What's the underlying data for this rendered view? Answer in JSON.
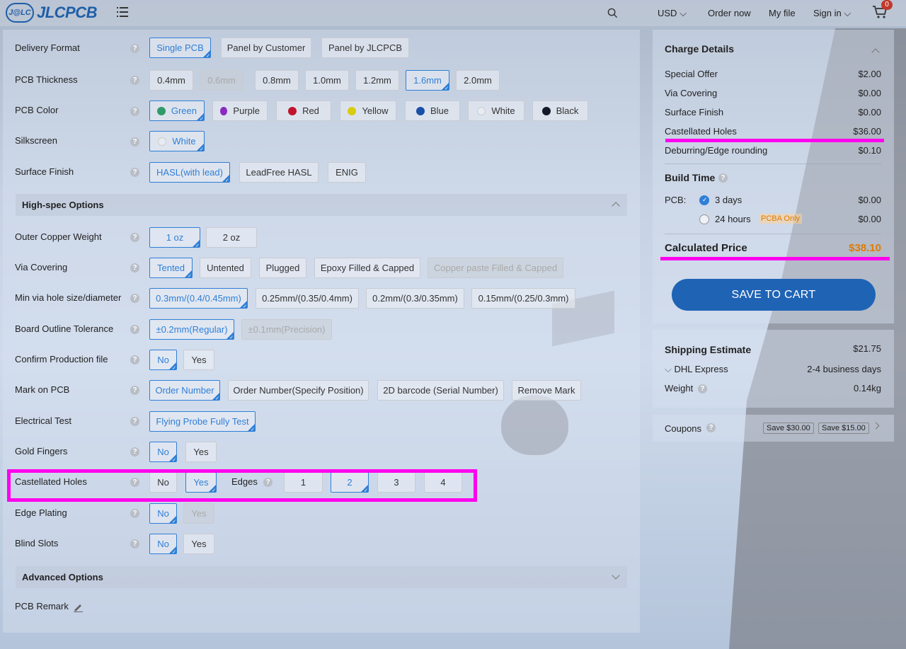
{
  "header": {
    "logo_mark": "J@LC",
    "logo_text": "JLCPCB",
    "currency": "USD",
    "order_now": "Order now",
    "my_file": "My file",
    "sign_in": "Sign in",
    "cart_count": "0"
  },
  "options": {
    "delivery": {
      "label": "Delivery Format",
      "items": [
        "Single PCB",
        "Panel by Customer",
        "Panel by JLCPCB"
      ]
    },
    "thickness": {
      "label": "PCB Thickness",
      "items": [
        "0.4mm",
        "0.6mm",
        "0.8mm",
        "1.0mm",
        "1.2mm",
        "1.6mm",
        "2.0mm"
      ]
    },
    "color": {
      "label": "PCB Color",
      "items": [
        "Green",
        "Purple",
        "Red",
        "Yellow",
        "Blue",
        "White",
        "Black"
      ]
    },
    "silkscreen": {
      "label": "Silkscreen",
      "items": [
        "White"
      ]
    },
    "finish": {
      "label": "Surface Finish",
      "items": [
        "HASL(with lead)",
        "LeadFree HASL",
        "ENIG"
      ]
    },
    "highspec_title": "High-spec Options",
    "copper": {
      "label": "Outer Copper Weight",
      "items": [
        "1 oz",
        "2 oz"
      ]
    },
    "via": {
      "label": "Via Covering",
      "items": [
        "Tented",
        "Untented",
        "Plugged",
        "Epoxy Filled & Capped",
        "Copper paste Filled & Capped"
      ]
    },
    "minvia": {
      "label": "Min via hole size/diameter",
      "items": [
        "0.3mm/(0.4/0.45mm)",
        "0.25mm/(0.35/0.4mm)",
        "0.2mm/(0.3/0.35mm)",
        "0.15mm/(0.25/0.3mm)"
      ]
    },
    "outline": {
      "label": "Board Outline Tolerance",
      "items": [
        "±0.2mm(Regular)",
        "±0.1mm(Precision)"
      ]
    },
    "confirm": {
      "label": "Confirm Production file",
      "items": [
        "No",
        "Yes"
      ]
    },
    "mark": {
      "label": "Mark on PCB",
      "items": [
        "Order Number",
        "Order Number(Specify Position)",
        "2D barcode (Serial Number)",
        "Remove Mark"
      ]
    },
    "etest": {
      "label": "Electrical Test",
      "items": [
        "Flying Probe Fully Test"
      ]
    },
    "gold": {
      "label": "Gold Fingers",
      "items": [
        "No",
        "Yes"
      ]
    },
    "castellated": {
      "label": "Castellated Holes",
      "items": [
        "No",
        "Yes"
      ],
      "edges_label": "Edges",
      "edges": [
        "1",
        "2",
        "3",
        "4"
      ]
    },
    "edgeplating": {
      "label": "Edge Plating",
      "items": [
        "No",
        "Yes"
      ]
    },
    "blindslots": {
      "label": "Blind Slots",
      "items": [
        "No",
        "Yes"
      ]
    },
    "advanced_title": "Advanced Options",
    "remark_label": "PCB Remark"
  },
  "charges": {
    "title": "Charge Details",
    "rows": [
      {
        "label": "Special Offer",
        "value": "$2.00"
      },
      {
        "label": "Via Covering",
        "value": "$0.00"
      },
      {
        "label": "Surface Finish",
        "value": "$0.00"
      },
      {
        "label": "Castellated Holes",
        "value": "$36.00"
      },
      {
        "label": "Deburring/Edge rounding",
        "value": "$0.10"
      }
    ],
    "build_title": "Build Time",
    "build_label": "PCB:",
    "build_opts": [
      {
        "label": "3 days",
        "value": "$0.00"
      },
      {
        "label": "24 hours",
        "value": "$0.00",
        "tag": "PCBA Only"
      }
    ],
    "calc_label": "Calculated Price",
    "calc_value": "$38.10",
    "save_label": "SAVE TO CART"
  },
  "shipping": {
    "title": "Shipping Estimate",
    "value": "$21.75",
    "method": "DHL Express",
    "days": "2-4 business days",
    "weight_label": "Weight",
    "weight": "0.14kg"
  },
  "coupons": {
    "label": "Coupons",
    "tags": [
      "Save $30.00",
      "Save $15.00"
    ]
  },
  "colors": {
    "accent": "#2f7fd6",
    "highlight": "#ff00ee",
    "price": "#e07b00",
    "button": "#1f63b5"
  }
}
